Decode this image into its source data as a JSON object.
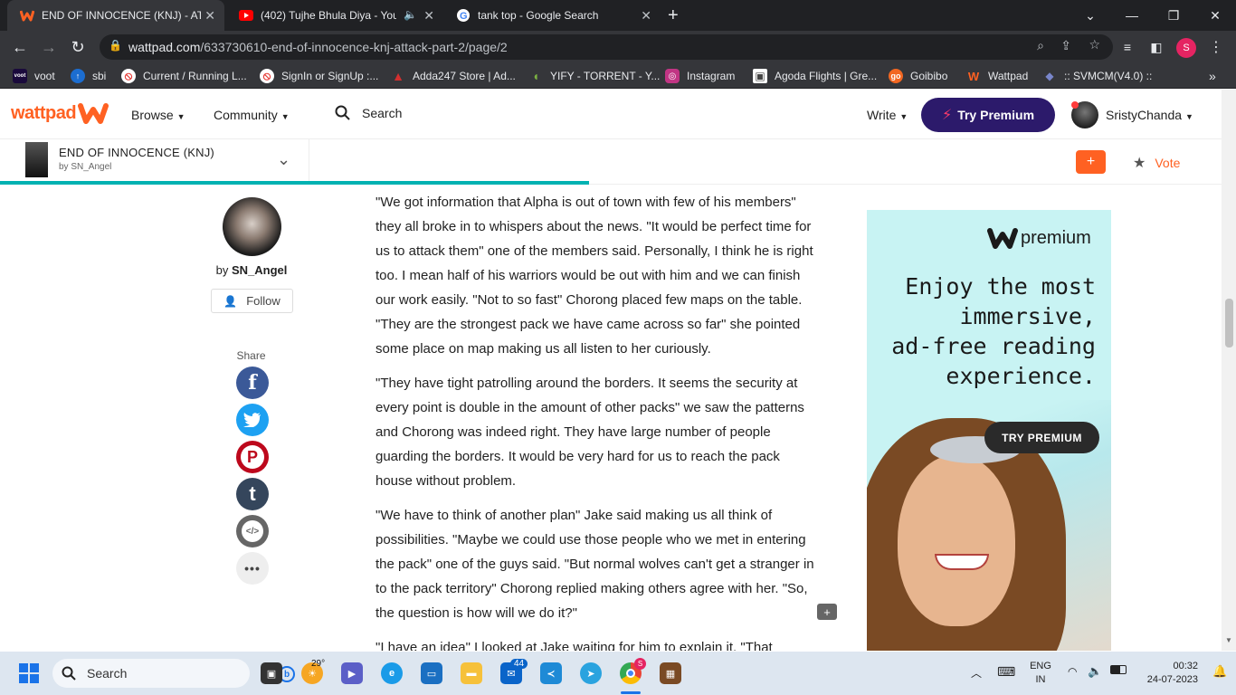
{
  "browser": {
    "tabs": [
      {
        "title": "END OF INNOCENCE (KNJ) - ATTA",
        "active": true
      },
      {
        "title": "(402) Tujhe Bhula Diya - YouT",
        "active": false
      },
      {
        "title": "tank top - Google Search",
        "active": false
      }
    ],
    "url_host": "wattpad.com",
    "url_path": "/633730610-end-of-innocence-knj-attack-part-2/page/2",
    "profile_initial": "S"
  },
  "bookmarks": [
    {
      "label": "voot",
      "icon_text": "voot",
      "color": "#1a0a3c"
    },
    {
      "label": "sbi",
      "icon_text": "↑",
      "color": "#1c6dd0"
    },
    {
      "label": "Current / Running L...",
      "icon_text": "⦸",
      "color": "#e53935"
    },
    {
      "label": "SignIn or SignUp :...",
      "icon_text": "⦸",
      "color": "#e53935"
    },
    {
      "label": "Adda247 Store | Ad...",
      "icon_text": "▲",
      "color": "#d32f2f"
    },
    {
      "label": "YIFY - TORRENT - Y...",
      "icon_text": "●",
      "color": "#7cb342"
    },
    {
      "label": "Instagram",
      "icon_text": "◎",
      "color": "#c13584"
    },
    {
      "label": "Agoda Flights | Gre...",
      "icon_text": "▣",
      "color": "#444444"
    },
    {
      "label": "Goibibo",
      "icon_text": "go",
      "color": "#f26722"
    },
    {
      "label": "Wattpad",
      "icon_text": "W",
      "color": "#ff6122"
    },
    {
      "label": ":: SVMCM(V4.0) ::",
      "icon_text": "🎓",
      "color": "#5c6bc0"
    }
  ],
  "site": {
    "logo_text": "wattpad",
    "browse_label": "Browse",
    "community_label": "Community",
    "search_label": "Search",
    "write_label": "Write",
    "try_premium_label": "Try Premium",
    "username": "SristyChanda"
  },
  "story": {
    "title": "END OF INNOCENCE (KNJ)",
    "by_line": "by SN_Angel",
    "add_label": "+",
    "vote_label": "Vote"
  },
  "author": {
    "by_prefix": "by",
    "name": "SN_Angel",
    "follow_label": "Follow",
    "share_label": "Share"
  },
  "share_buttons": [
    {
      "name": "facebook",
      "glyph": "f",
      "color": "#3b5998"
    },
    {
      "name": "twitter",
      "glyph": "🐦",
      "color": "#1da1f2"
    },
    {
      "name": "pinterest",
      "glyph": "P",
      "color": "#bd081c"
    },
    {
      "name": "tumblr",
      "glyph": "t",
      "color": "#35465c"
    },
    {
      "name": "embed",
      "glyph": "</>",
      "color": "#666666"
    },
    {
      "name": "more",
      "glyph": "•••",
      "color": "#eeeeee"
    }
  ],
  "paragraphs": [
    "\"We got information that Alpha is out of town with few of his members\" they all broke in to whispers about the news. \"It would be perfect time for us to attack them\" one of the members said. Personally, I think he is right too. I mean half of his warriors would be out with him and we can finish our work easily. \"Not to so fast\" Chorong placed few maps on the table. \"They are the strongest pack we have came across so far\" she pointed some place on map making us all listen to her curiously.",
    "\"They have tight patrolling around the borders. It seems the security at every point is double in the amount of other packs\" we saw the patterns and Chorong was indeed right. They have large number of people guarding the borders. It would be very hard for us to reach the pack house without problem.",
    "\"We have to think of another plan\" Jake said making us all think of possibilities. \"Maybe we could use those people who we met in entering the pack\" one of the guys said. \"But normal wolves can't get a stranger in to the pack territory\" Chorong replied making others agree with her. \"So, the question is how will we do it?\"",
    "\"I have an idea\" I looked at Jake waiting for him to explain it. \"That"
  ],
  "ad": {
    "brand": "premium",
    "headline_lines": [
      "Enjoy the most",
      "immersive,",
      "ad-free reading",
      "experience."
    ],
    "cta": "TRY PREMIUM",
    "bg_color": "#c8f3f3"
  },
  "taskbar": {
    "search_label": "Search",
    "weather": "29°",
    "mail_badge": "44",
    "chrome_badge": "S",
    "lang_top": "ENG",
    "lang_bottom": "IN",
    "time": "00:32",
    "date": "24-07-2023"
  }
}
